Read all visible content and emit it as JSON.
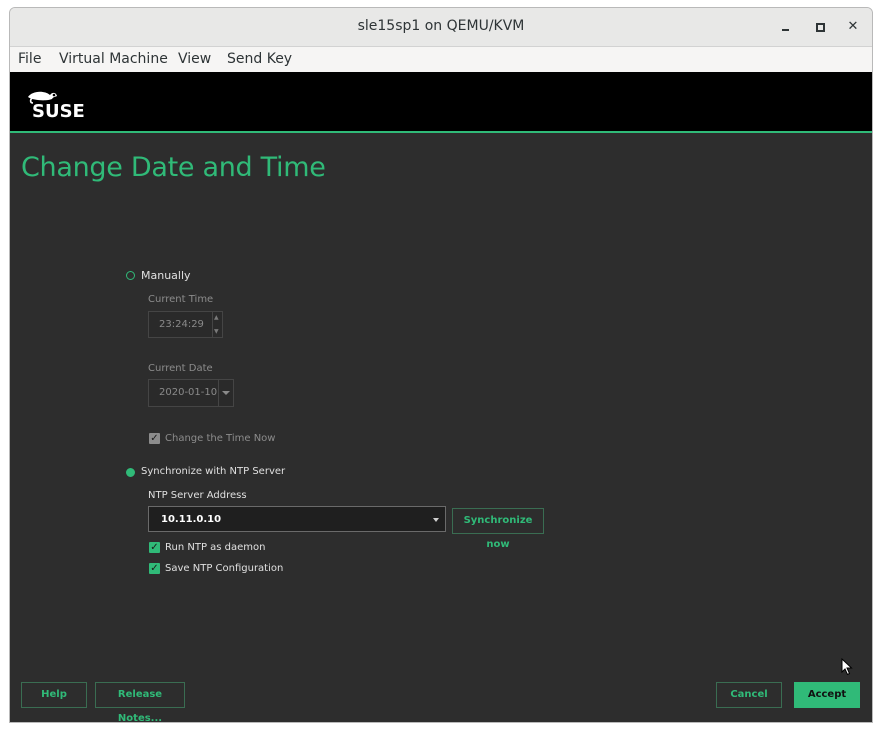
{
  "window": {
    "title": "sle15sp1 on QEMU/KVM"
  },
  "menubar": {
    "items": [
      "File",
      "Virtual Machine",
      "View",
      "Send Key"
    ]
  },
  "header": {
    "logo_text": "SUSE"
  },
  "page": {
    "title": "Change Date and Time"
  },
  "manual": {
    "radio_label": "Manually",
    "time_label": "Current Time",
    "time_value": "23:24:29",
    "date_label": "Current Date",
    "date_value": "2020-01-10",
    "change_time_label": "Change the Time Now"
  },
  "ntp": {
    "radio_label": "Synchronize with NTP Server",
    "server_label": "NTP Server Address",
    "server_value": "10.11.0.10",
    "sync_button": "Synchronize now",
    "daemon_label": "Run NTP as daemon",
    "save_label": "Save NTP Configuration"
  },
  "footer": {
    "help": "Help",
    "release_notes": "Release Notes...",
    "cancel": "Cancel",
    "accept": "Accept"
  },
  "colors": {
    "accent": "#30ba78",
    "background": "#2d2d2d",
    "header": "#000000"
  }
}
